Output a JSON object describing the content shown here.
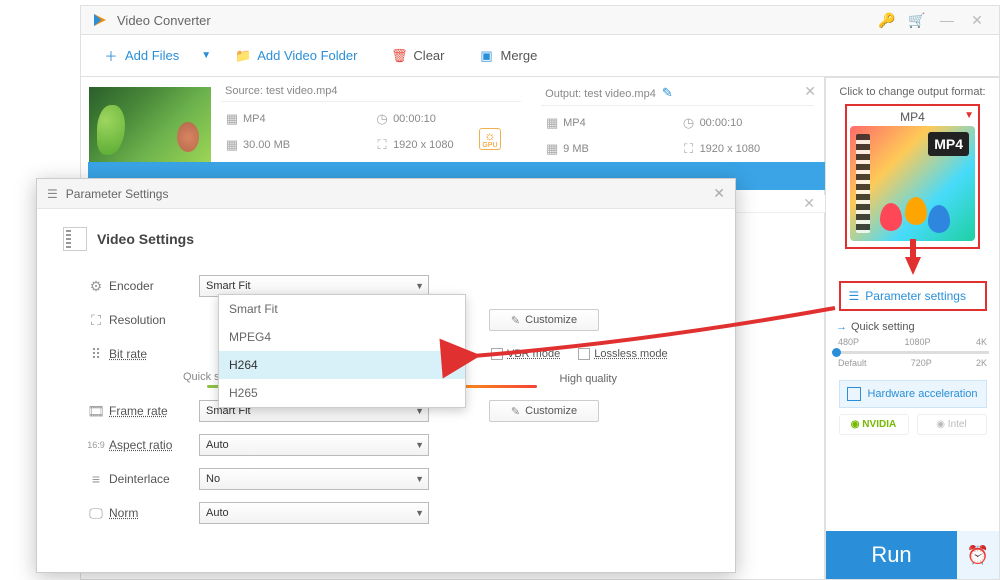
{
  "window": {
    "title": "Video Converter"
  },
  "toolbar": {
    "add_files": "Add Files",
    "add_folder": "Add Video Folder",
    "clear": "Clear",
    "merge": "Merge"
  },
  "file": {
    "source_label": "Source: test video.mp4",
    "output_label": "Output: test video.mp4",
    "src": {
      "format": "MP4",
      "duration": "00:00:10",
      "size": "30.00 MB",
      "res": "1920 x 1080"
    },
    "out": {
      "format": "MP4",
      "duration": "00:00:10",
      "size": "9 MB",
      "res": "1920 x 1080"
    },
    "gpu": "GPU"
  },
  "rpanel": {
    "hdr": "Click to change output format:",
    "format_title": "MP4",
    "badge": "MP4",
    "param_btn": "Parameter settings",
    "quick": "Quick setting",
    "marks_top": [
      "480P",
      "1080P",
      "4K"
    ],
    "marks_bot": [
      "Default",
      "720P",
      "2K"
    ],
    "hw": "Hardware acceleration",
    "nvidia": "NVIDIA",
    "intel": "Intel",
    "run": "Run"
  },
  "dialog": {
    "title": "Parameter Settings",
    "section": "Video Settings",
    "fields": {
      "encoder": "Encoder",
      "resolution": "Resolution",
      "bitrate": "Bit rate",
      "framerate": "Frame rate",
      "aspect": "Aspect ratio",
      "deinterlace": "Deinterlace",
      "norm": "Norm"
    },
    "values": {
      "encoder": "Smart Fit",
      "framerate": "Smart Fit",
      "aspect": "Auto",
      "deinterlace": "No",
      "norm": "Auto"
    },
    "customize": "Customize",
    "vbr": "VBR mode",
    "lossless": "Lossless mode",
    "quick_setting": "Quick setting",
    "quality": "High quality",
    "encoder_options": [
      "Smart Fit",
      "MPEG4",
      "H264",
      "H265"
    ]
  }
}
